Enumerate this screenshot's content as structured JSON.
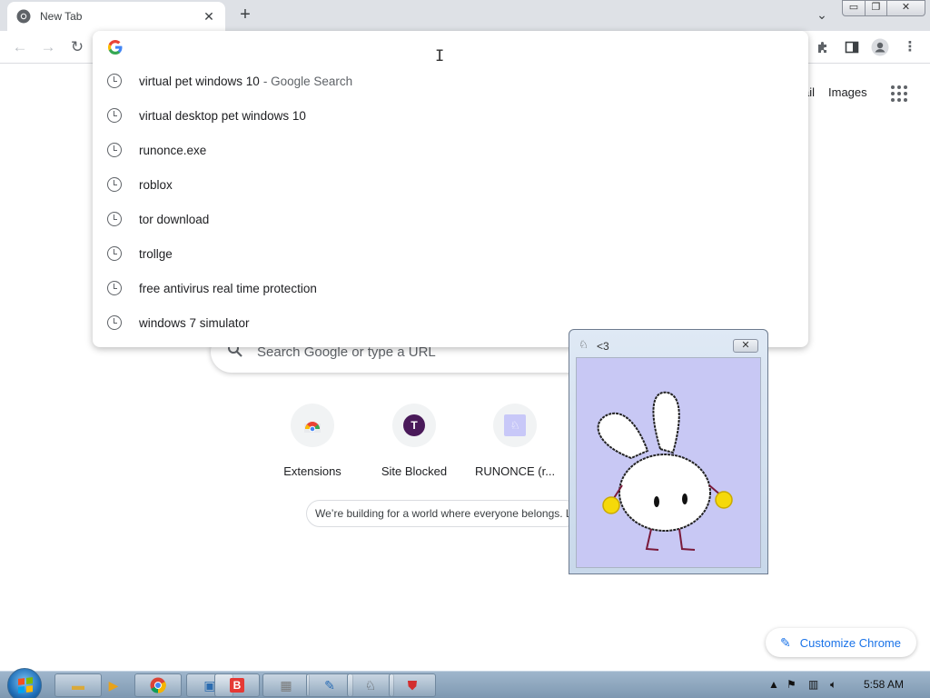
{
  "browser": {
    "tab_title": "New Tab",
    "tab_close": "✕",
    "new_tab": "+",
    "tab_search": "⌄",
    "window_controls": {
      "minimize": "▭",
      "maximize": "❐",
      "close": "✕"
    }
  },
  "omnibox": {
    "suggestions": [
      {
        "text": "virtual pet windows 10",
        "suffix": "- Google Search"
      },
      {
        "text": "virtual desktop pet windows 10",
        "suffix": ""
      },
      {
        "text": "runonce.exe",
        "suffix": ""
      },
      {
        "text": "roblox",
        "suffix": ""
      },
      {
        "text": "tor download",
        "suffix": ""
      },
      {
        "text": "trollge",
        "suffix": ""
      },
      {
        "text": "free antivirus real time protection",
        "suffix": ""
      },
      {
        "text": "windows 7 simulator",
        "suffix": ""
      }
    ]
  },
  "ntp": {
    "header_links": {
      "gmail_partial": "ail",
      "images": "Images"
    },
    "search_placeholder": "Search Google or type a URL",
    "shortcuts": [
      {
        "label": "Extensions",
        "icon": "chrome-web-store-icon"
      },
      {
        "label": "Site Blocked",
        "icon": "letter-t-icon",
        "initial": "T"
      },
      {
        "label": "RUNONCE (r...",
        "icon": "runonce-icon"
      }
    ],
    "promo_text": "We’re building for a world where everyone belongs. L",
    "customize_label": "Customize Chrome"
  },
  "pet_window": {
    "title": "<3",
    "close": "✕"
  },
  "taskbar": {
    "buttons": [
      "file-explorer-icon",
      "media-player-icon",
      "chrome-icon",
      "monitor-app-icon",
      "b-app-icon",
      "wall-app-icon",
      "app-icon",
      "pet-app-icon",
      "shield-app-icon"
    ],
    "clock": "5:58 AM"
  },
  "colors": {
    "accent": "#1a73e8",
    "tab_strip": "#dee1e6",
    "pet_bg": "#c8c8f4",
    "taskbar": "#8aa3bb"
  }
}
